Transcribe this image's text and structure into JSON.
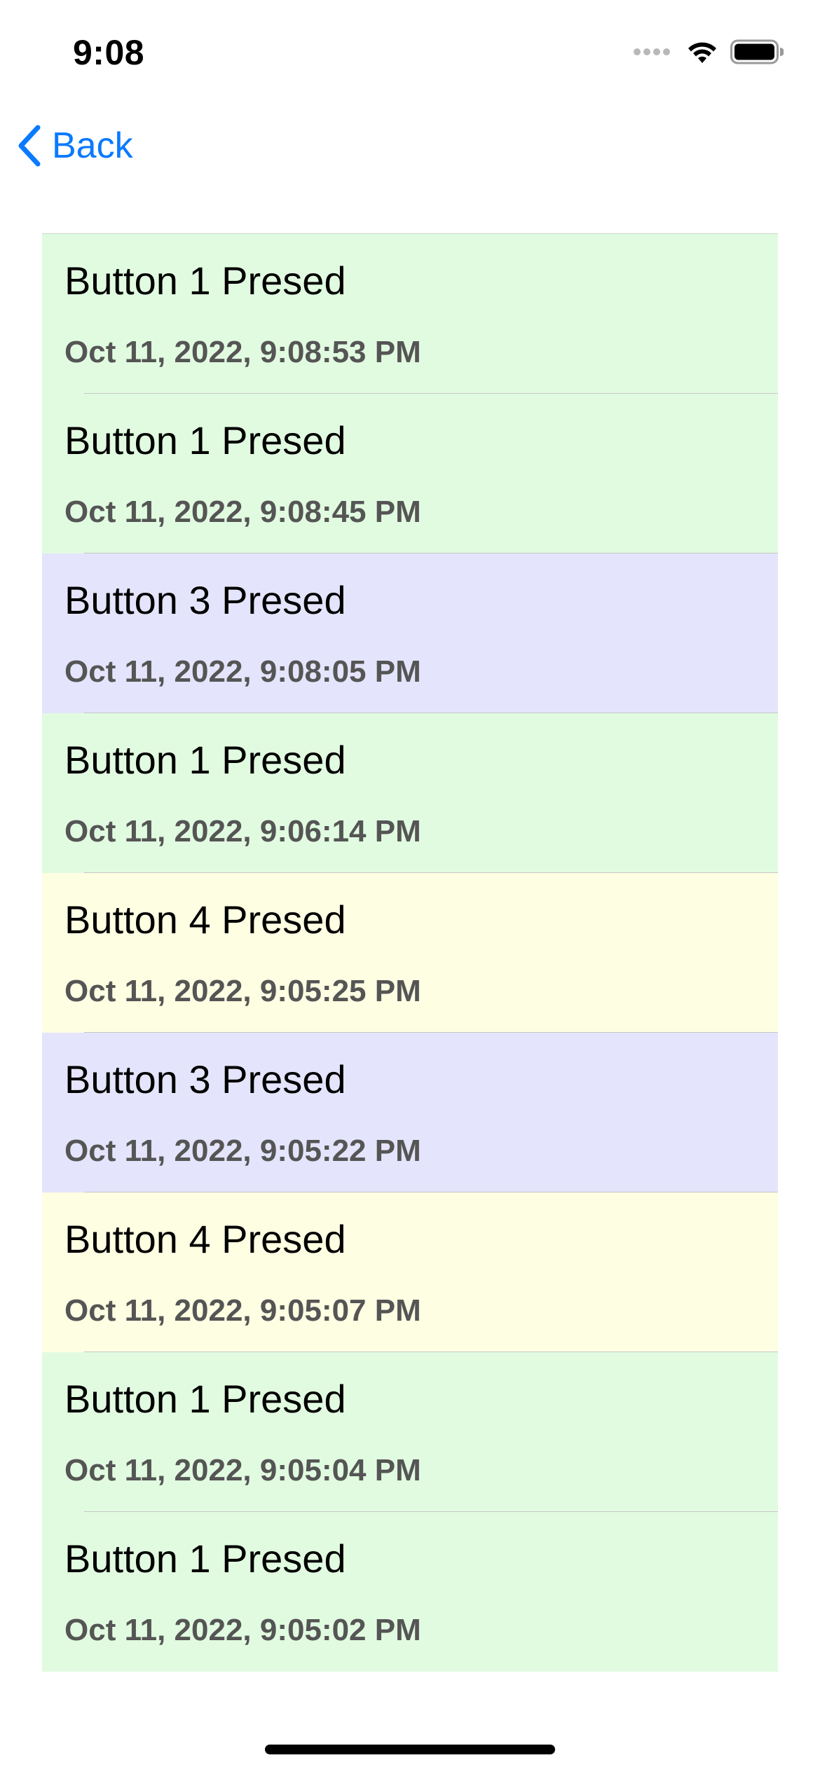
{
  "status_bar": {
    "time": "9:08"
  },
  "nav": {
    "back_label": "Back",
    "back_icon": "chevron-left-icon"
  },
  "colors": {
    "accent": "#0a7aff",
    "green_row": "#e1fbe0",
    "blue_row": "#e4e4fc",
    "yellow_row": "#fdfee2"
  },
  "log_items": [
    {
      "title": "Button 1 Presed",
      "date": "Oct 11, 2022, 9:08:53 PM",
      "color": "green"
    },
    {
      "title": "Button 1 Presed",
      "date": "Oct 11, 2022, 9:08:45 PM",
      "color": "green"
    },
    {
      "title": "Button 3 Presed",
      "date": "Oct 11, 2022, 9:08:05 PM",
      "color": "blue"
    },
    {
      "title": "Button 1 Presed",
      "date": "Oct 11, 2022, 9:06:14 PM",
      "color": "green"
    },
    {
      "title": "Button 4 Presed",
      "date": "Oct 11, 2022, 9:05:25 PM",
      "color": "yellow"
    },
    {
      "title": "Button 3 Presed",
      "date": "Oct 11, 2022, 9:05:22 PM",
      "color": "blue"
    },
    {
      "title": "Button 4 Presed",
      "date": "Oct 11, 2022, 9:05:07 PM",
      "color": "yellow"
    },
    {
      "title": "Button 1 Presed",
      "date": "Oct 11, 2022, 9:05:04 PM",
      "color": "green"
    },
    {
      "title": "Button 1 Presed",
      "date": "Oct 11, 2022, 9:05:02 PM",
      "color": "green"
    }
  ]
}
